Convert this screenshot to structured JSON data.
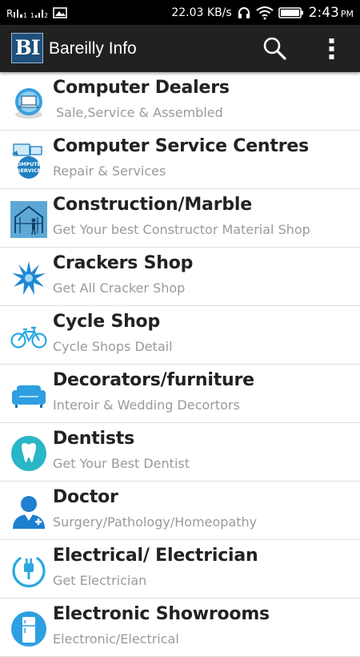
{
  "status_bar": {
    "speed": "22.03 KB/s",
    "time": "2:43",
    "ampm": "PM",
    "icons": [
      "signal-icon",
      "signal-bars-icon",
      "image-icon",
      "headset-icon",
      "wifi-icon",
      "battery-icon"
    ]
  },
  "app_bar": {
    "logo_text": "BI",
    "title": "Bareilly Info",
    "icons": [
      "search-icon",
      "overflow-menu-icon"
    ]
  },
  "categories": [
    {
      "title": "Computer Dealers",
      "subtitle": "Sale,Service & Assembled",
      "icon": "computer-dealers-icon"
    },
    {
      "title": "Computer Service Centres",
      "subtitle": "Repair & Services",
      "icon": "computer-service-icon",
      "icon_text": "COMPUTER SERVICE"
    },
    {
      "title": "Construction/Marble",
      "subtitle": "Get Your best Constructor Material Shop",
      "icon": "construction-icon"
    },
    {
      "title": "Crackers Shop",
      "subtitle": "Get All Cracker Shop",
      "icon": "cracker-burst-icon"
    },
    {
      "title": "Cycle Shop",
      "subtitle": "Cycle Shops Detail",
      "icon": "bicycle-icon"
    },
    {
      "title": "Decorators/furniture",
      "subtitle": "Interoir & Wedding Decortors",
      "icon": "sofa-icon"
    },
    {
      "title": "Dentists",
      "subtitle": "Get Your Best Dentist",
      "icon": "tooth-icon"
    },
    {
      "title": "Doctor",
      "subtitle": "Surgery/Pathology/Homeopathy",
      "icon": "doctor-icon"
    },
    {
      "title": "Electrical/ Electrician",
      "subtitle": "Get Electrician",
      "icon": "plug-icon"
    },
    {
      "title": "Electronic Showrooms",
      "subtitle": "Electronic/Electrical",
      "icon": "refrigerator-icon"
    }
  ],
  "colors": {
    "status_bar": "#000000",
    "app_bar": "#212121",
    "logo_bg": "#1f4f7a",
    "title_text": "#222222",
    "subtitle_text": "#9a9a9a",
    "divider": "#dedede",
    "icon_blue": "#29a8e0",
    "icon_teal": "#29b6c6"
  }
}
